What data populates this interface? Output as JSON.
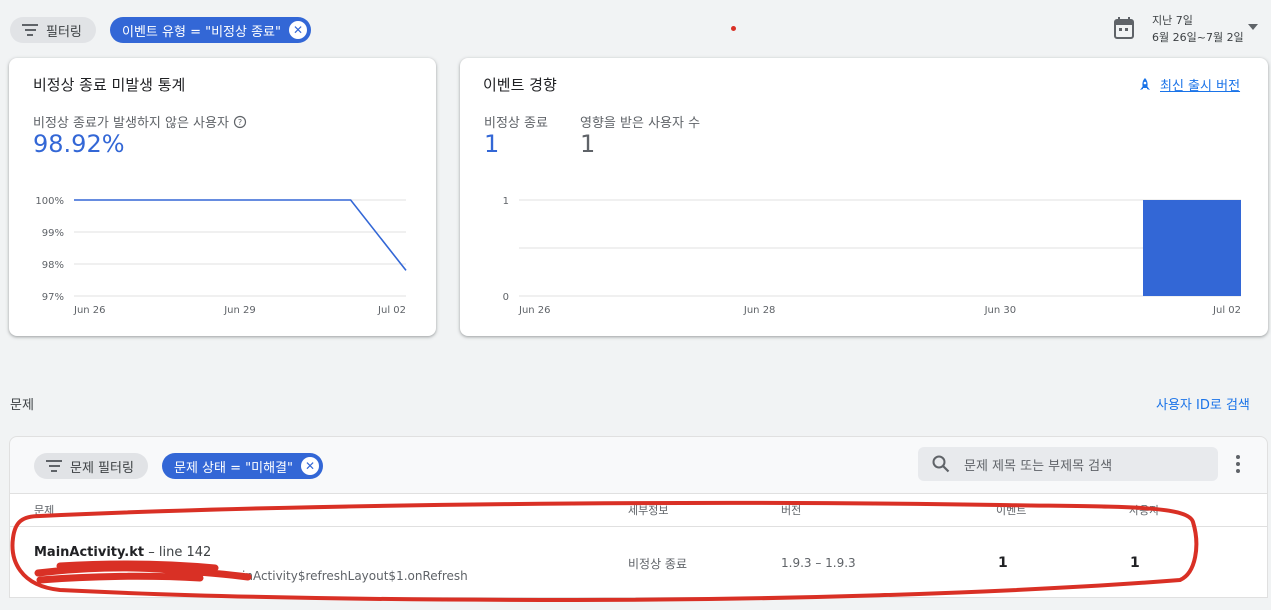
{
  "colors": {
    "accent": "#3367d6",
    "link": "#1a73e8",
    "annotation": "#d93025"
  },
  "topbar": {
    "filter_label": "필터링",
    "event_type_chip": "이벤트 유형 = \"비정상 종료\"",
    "date_range_title": "지난 7일",
    "date_range_value": "6월 26일~7월 2일"
  },
  "crash_free_card": {
    "title": "비정상 종료 미발생 통계",
    "metric_label": "비정상 종료가 발생하지 않은 사용자",
    "metric_value": "98.92%"
  },
  "event_trend_card": {
    "title": "이벤트 경향",
    "latest_release_link": "최신 출시 버전",
    "metrics": [
      {
        "label": "비정상 종료",
        "value": "1"
      },
      {
        "label": "영향을 받은 사용자 수",
        "value": "1"
      }
    ]
  },
  "chart_data": [
    {
      "type": "line",
      "ylabel": "",
      "xlabel": "",
      "x_tick_labels": [
        "Jun 26",
        "Jun 29",
        "Jul 02"
      ],
      "y_tick_labels": [
        "100%",
        "99%",
        "98%",
        "97%"
      ],
      "ylim": [
        97,
        100
      ],
      "x": [
        "Jun 26",
        "Jun 27",
        "Jun 28",
        "Jun 29",
        "Jun 30",
        "Jul 01",
        "Jul 02"
      ],
      "values": [
        100,
        100,
        100,
        100,
        100,
        100,
        97.8
      ],
      "grid": true
    },
    {
      "type": "bar",
      "ylabel": "",
      "xlabel": "",
      "x_tick_labels": [
        "Jun 26",
        "Jun 28",
        "Jun 30",
        "Jul 02"
      ],
      "y_tick_labels": [
        "1",
        "0"
      ],
      "ylim": [
        0,
        1
      ],
      "categories": [
        "Jun 26",
        "Jun 27",
        "Jun 28",
        "Jun 29",
        "Jun 30",
        "Jul 01",
        "Jul 02"
      ],
      "values": [
        0,
        0,
        0,
        0,
        0,
        0,
        1
      ],
      "grid": true
    }
  ],
  "issues_section": {
    "heading": "문제",
    "search_by_user_link": "사용자 ID로 검색",
    "issue_filter_label": "문제 필터링",
    "issue_state_chip": "문제 상태 = \"미해결\"",
    "search_placeholder": "문제 제목 또는 부제목 검색",
    "columns": [
      "문제",
      "세부정보",
      "버전",
      "이벤트",
      "사용자"
    ],
    "rows": [
      {
        "title": "MainActivity.kt",
        "line": " – line 142",
        "subtitle": "inActivity$refreshLayout$1.onRefresh",
        "details": "비정상 종료",
        "versions": "1.9.3 – 1.9.3",
        "events": "1",
        "users": "1"
      }
    ]
  }
}
